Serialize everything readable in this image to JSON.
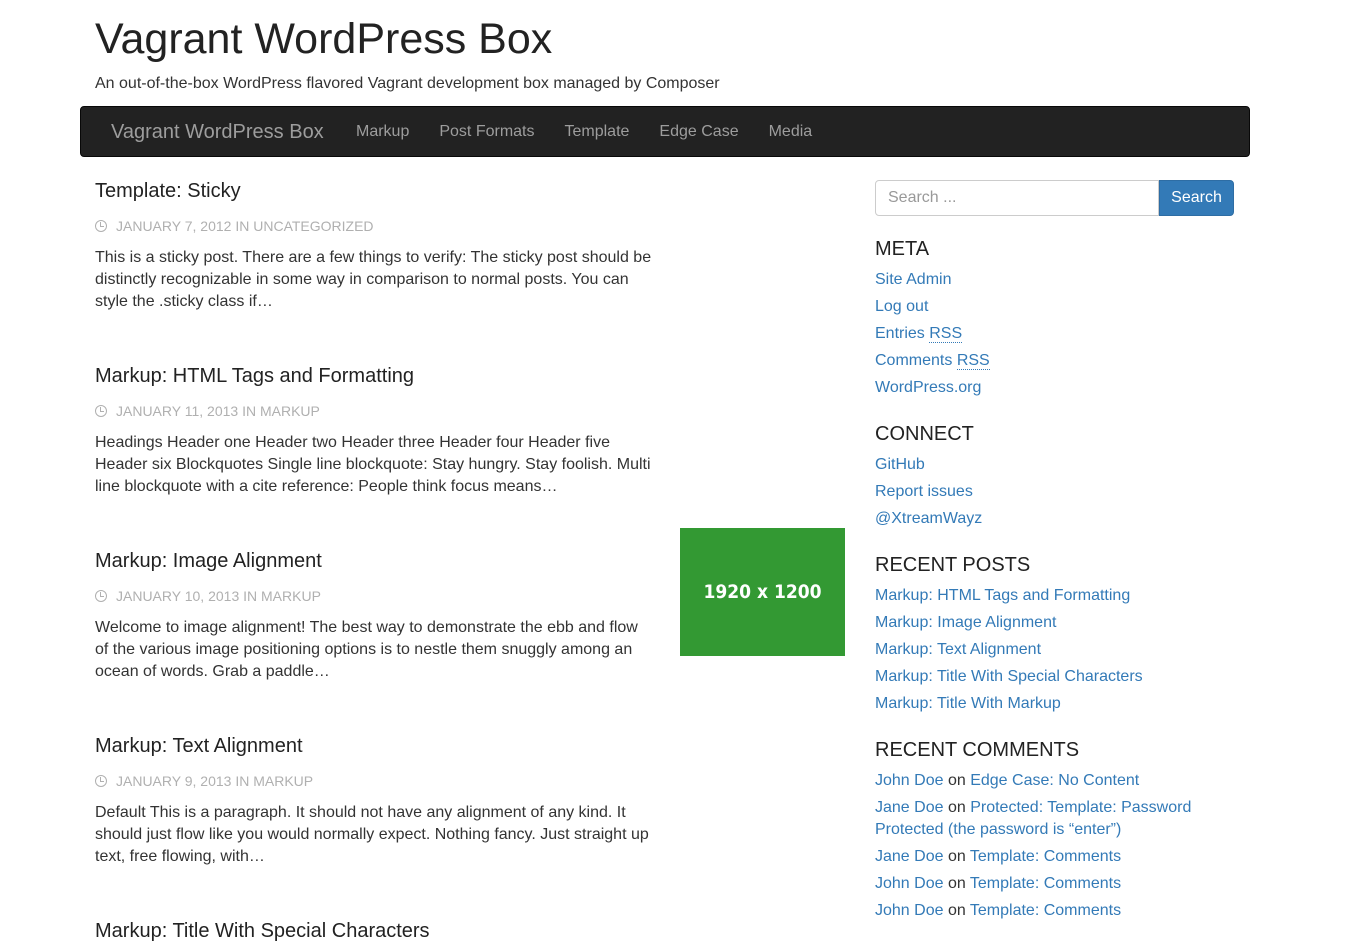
{
  "site": {
    "title": "Vagrant WordPress Box",
    "description": "An out-of-the-box WordPress flavored Vagrant development box managed by Composer"
  },
  "nav": {
    "brand": "Vagrant WordPress Box",
    "items": [
      "Markup",
      "Post Formats",
      "Template",
      "Edge Case",
      "Media"
    ]
  },
  "posts": [
    {
      "title": "Template: Sticky",
      "date": "JANUARY 7, 2012",
      "in": "IN",
      "category": "UNCATEGORIZED",
      "excerpt": "This is a sticky post. There are a few things to verify: The sticky post should be distinctly recognizable in some way in comparison to normal posts. You can style the .sticky class if…"
    },
    {
      "title": "Markup: HTML Tags and Formatting",
      "date": "JANUARY 11, 2013",
      "in": "IN",
      "category": "MARKUP",
      "excerpt": "Headings Header one Header two Header three Header four Header five Header six Blockquotes Single line blockquote: Stay hungry. Stay foolish. Multi line blockquote with a cite reference: People think focus means…"
    },
    {
      "title": "Markup: Image Alignment",
      "date": "JANUARY 10, 2013",
      "in": "IN",
      "category": "MARKUP",
      "excerpt": "Welcome to image alignment! The best way to demonstrate the ebb and flow of the various image positioning options is to nestle them snuggly among an ocean of words. Grab a paddle…",
      "thumbnail": "1920 x 1200"
    },
    {
      "title": "Markup: Text Alignment",
      "date": "JANUARY 9, 2013",
      "in": "IN",
      "category": "MARKUP",
      "excerpt": "Default This is a paragraph. It should not have any alignment of any kind. It should just flow like you would normally expect. Nothing fancy. Just straight up text, free flowing, with…"
    },
    {
      "title": "Markup: Title With Special Characters"
    }
  ],
  "sidebar": {
    "search": {
      "placeholder": "Search ...",
      "button": "Search"
    },
    "meta": {
      "title": "META",
      "site_admin": "Site Admin",
      "log_out": "Log out",
      "entries": "Entries",
      "comments": "Comments",
      "rss": "RSS",
      "wordpress": "WordPress.org"
    },
    "connect": {
      "title": "CONNECT",
      "items": [
        "GitHub",
        "Report issues",
        "@XtreamWayz"
      ]
    },
    "recent_posts": {
      "title": "RECENT POSTS",
      "items": [
        "Markup: HTML Tags and Formatting",
        "Markup: Image Alignment",
        "Markup: Text Alignment",
        "Markup: Title With Special Characters",
        "Markup: Title With Markup"
      ]
    },
    "recent_comments": {
      "title": "RECENT COMMENTS",
      "on": "on",
      "items": [
        {
          "author": "John Doe",
          "post": "Edge Case: No Content"
        },
        {
          "author": "Jane Doe",
          "post": "Protected: Template: Password Protected (the password is “enter”)"
        },
        {
          "author": "Jane Doe",
          "post": "Template: Comments"
        },
        {
          "author": "John Doe",
          "post": "Template: Comments"
        },
        {
          "author": "John Doe",
          "post": "Template: Comments"
        }
      ]
    }
  }
}
